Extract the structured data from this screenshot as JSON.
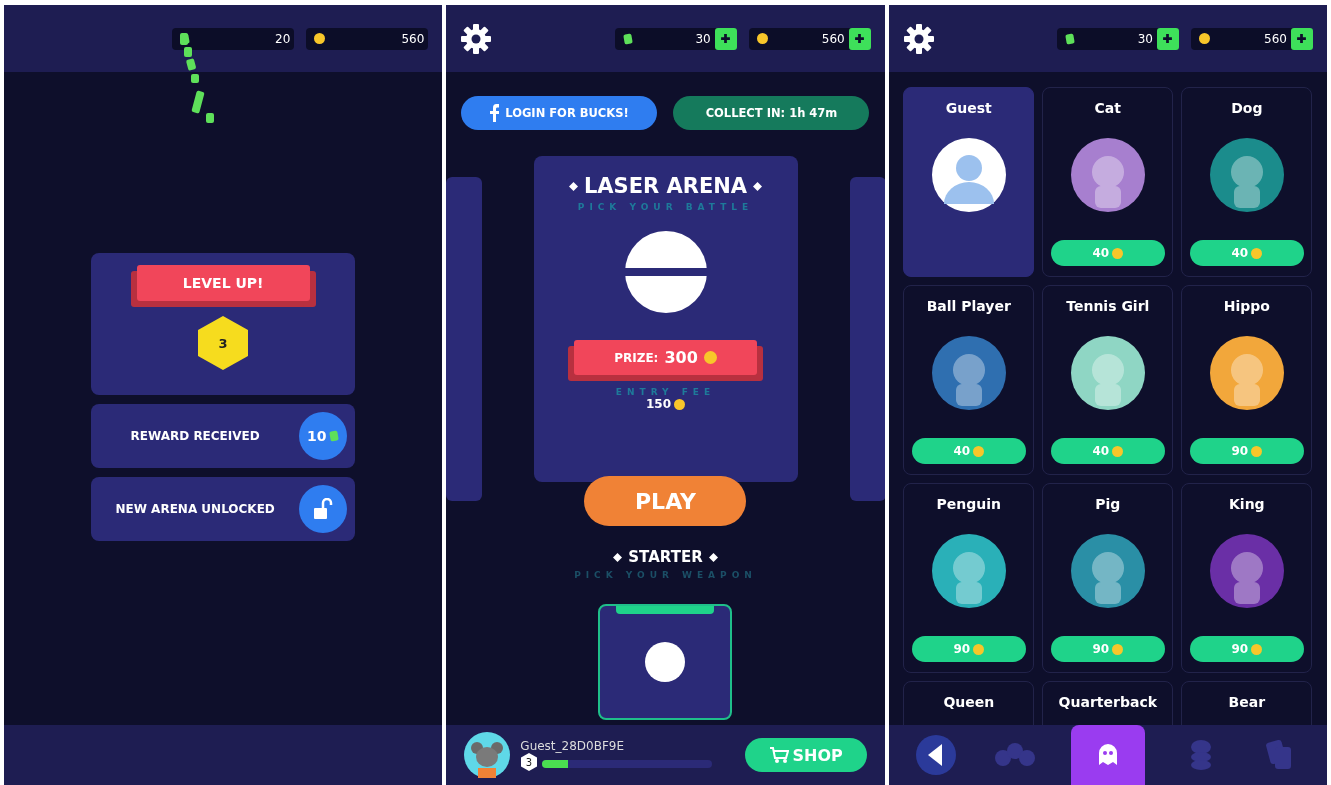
{
  "screens": [
    {
      "kind": "reward",
      "counters": [
        {
          "kind": "gem",
          "value": "20",
          "plus": false
        },
        {
          "kind": "coin",
          "value": "560",
          "plus": false
        }
      ],
      "level_card": {
        "title": "LEVEL UP!",
        "level": "3"
      },
      "rewards": [
        {
          "kind": "gems",
          "label": "REWARD RECEIVED",
          "value": "10"
        },
        {
          "kind": "unlock",
          "label": "NEW ARENA UNLOCKED"
        }
      ]
    },
    {
      "kind": "arena",
      "counters": [
        {
          "kind": "gem",
          "value": "30",
          "plus": true
        },
        {
          "kind": "coin",
          "value": "560",
          "plus": true
        }
      ],
      "login_button": "LOGIN FOR BUCKS!",
      "collect_button": "COLLECT IN: 1h 47m",
      "arena": {
        "title": "LASER ARENA",
        "subtitle": "PICK YOUR BATTLE",
        "prize_label": "PRIZE:",
        "prize": "300",
        "fee_label": "ENTRY FEE",
        "fee": "150"
      },
      "play_button": "PLAY",
      "weapon": {
        "title": "STARTER",
        "subtitle": "PICK YOUR WEAPON",
        "selected": true
      },
      "player": {
        "name": "Guest_28D0BF9E",
        "level_badge": "3",
        "level": 0.15
      },
      "shop_button": "SHOP"
    },
    {
      "kind": "avatars",
      "counters": [
        {
          "kind": "gem",
          "value": "30",
          "plus": true
        },
        {
          "kind": "coin",
          "value": "560",
          "plus": true
        }
      ],
      "avatars": [
        {
          "name": "Guest",
          "selected": true,
          "color": "#ffffff"
        },
        {
          "name": "Cat",
          "price": "40",
          "selected": false,
          "color": "#a77fcf"
        },
        {
          "name": "Dog",
          "price": "40",
          "selected": false,
          "color": "#1b8c8c"
        },
        {
          "name": "Ball Player",
          "price": "40",
          "selected": false,
          "color": "#2f6fb0"
        },
        {
          "name": "Tennis Girl",
          "price": "40",
          "selected": false,
          "color": "#8fd6c4"
        },
        {
          "name": "Hippo",
          "price": "90",
          "selected": false,
          "color": "#f2a73b"
        },
        {
          "name": "Penguin",
          "price": "90",
          "selected": false,
          "color": "#2ab0b8"
        },
        {
          "name": "Pig",
          "price": "90",
          "selected": false,
          "color": "#2a8fa6"
        },
        {
          "name": "King",
          "price": "90",
          "selected": false,
          "color": "#6a2fa6"
        },
        {
          "name": "Queen",
          "selected": false
        },
        {
          "name": "Quarterback",
          "selected": false
        },
        {
          "name": "Bear",
          "selected": false
        }
      ],
      "nav": [
        {
          "kind": "back",
          "selected": false
        },
        {
          "kind": "balls",
          "selected": false
        },
        {
          "kind": "avatar",
          "selected": true
        },
        {
          "kind": "coins",
          "selected": false
        },
        {
          "kind": "cards",
          "selected": false
        }
      ]
    }
  ]
}
